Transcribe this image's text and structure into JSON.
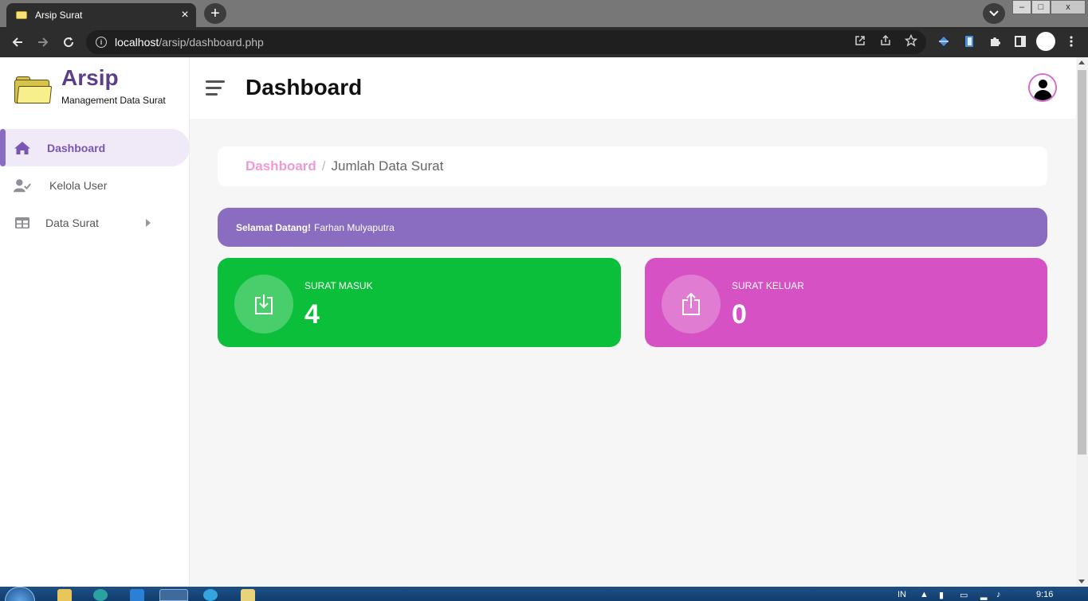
{
  "browser": {
    "tab_title": "Arsip Surat",
    "tab_close": "×",
    "new_tab": "+",
    "url_host": "localhost",
    "url_path": "/arsip/dashboard.php",
    "win_min": "–",
    "win_max": "□",
    "win_close": "x"
  },
  "sidebar": {
    "brand_title": "Arsip",
    "brand_subtitle": "Management Data Surat",
    "items": [
      {
        "label": "Dashboard",
        "icon": "home-icon",
        "active": true
      },
      {
        "label": "Kelola User",
        "icon": "user-check-icon",
        "active": false
      },
      {
        "label": "Data Surat",
        "icon": "table-icon",
        "active": false,
        "has_submenu": true
      }
    ]
  },
  "header": {
    "title": "Dashboard"
  },
  "breadcrumb": {
    "link": "Dashboard",
    "separator": "/",
    "current": "Jumlah Data Surat"
  },
  "welcome": {
    "greeting": "Selamat Datang!",
    "name": "Farhan Mulyaputra"
  },
  "cards": [
    {
      "label": "SURAT MASUK",
      "value": "4",
      "color": "#0bbf3b",
      "icon": "download-icon"
    },
    {
      "label": "SURAT KELUAR",
      "value": "0",
      "color": "#d651c3",
      "icon": "share-icon"
    }
  ],
  "taskbar": {
    "lang": "IN",
    "time": "9:16"
  },
  "colors": {
    "accent_purple": "#8a6cc1",
    "breadcrumb_link": "#f09ad4"
  }
}
